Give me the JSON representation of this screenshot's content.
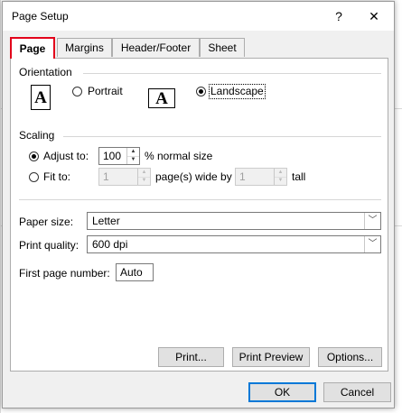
{
  "window": {
    "title": "Page Setup",
    "help_glyph": "?",
    "close_glyph": "✕"
  },
  "tabs": [
    {
      "label": "Page",
      "active": true
    },
    {
      "label": "Margins",
      "active": false
    },
    {
      "label": "Header/Footer",
      "active": false
    },
    {
      "label": "Sheet",
      "active": false
    }
  ],
  "orientation": {
    "group_label": "Orientation",
    "icon_letter": "A",
    "portrait_label": "Portrait",
    "landscape_label": "Landscape",
    "selected": "landscape"
  },
  "scaling": {
    "group_label": "Scaling",
    "adjust_label": "Adjust to:",
    "adjust_value": "100",
    "adjust_suffix": "% normal size",
    "fit_label": "Fit to:",
    "fit_wide_value": "1",
    "fit_wide_suffix": "page(s) wide by",
    "fit_tall_value": "1",
    "fit_tall_suffix": "tall",
    "selected": "adjust"
  },
  "paper": {
    "paper_size_label": "Paper size:",
    "paper_size_value": "Letter",
    "print_quality_label": "Print quality:",
    "print_quality_value": "600 dpi",
    "first_page_label": "First page number:",
    "first_page_value": "Auto"
  },
  "buttons": {
    "print": "Print...",
    "print_preview": "Print Preview",
    "options": "Options...",
    "ok": "OK",
    "cancel": "Cancel"
  },
  "colors": {
    "active_tab_highlight": "#e2001a",
    "default_button_border": "#0078d7"
  }
}
